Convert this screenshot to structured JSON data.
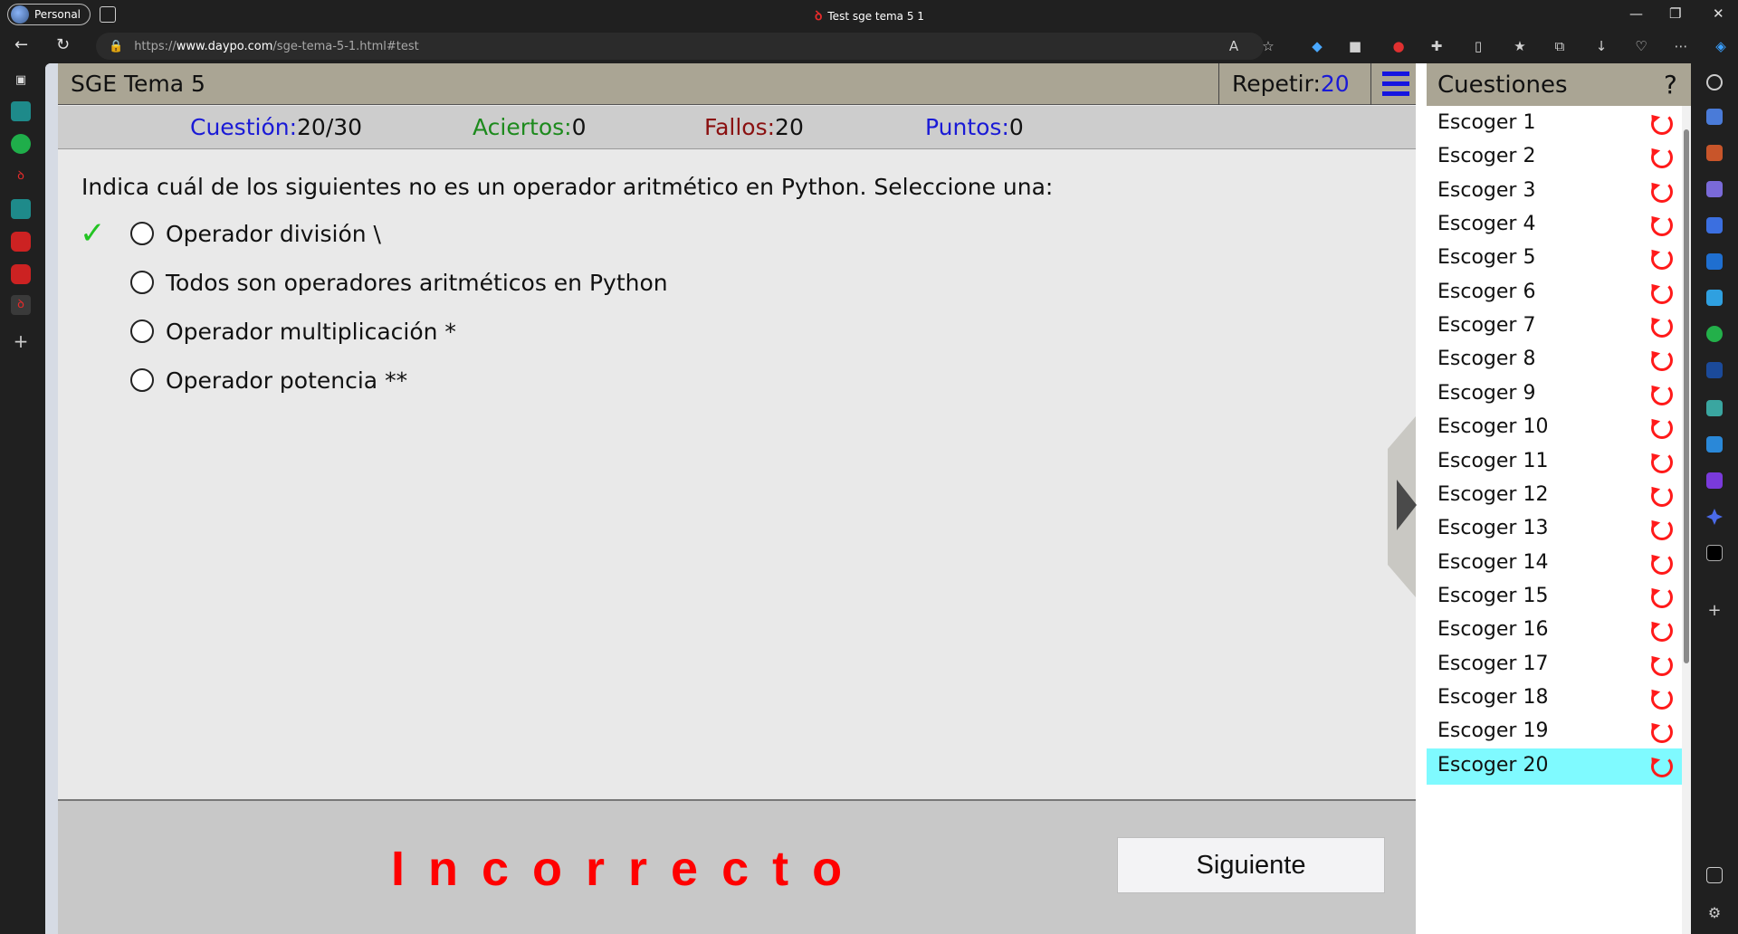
{
  "browser": {
    "profile_label": "Personal",
    "tab_title": "Test sge tema 5 1",
    "url_prefix": "https://",
    "url_domain": "www.daypo.com",
    "url_path": "/sge-tema-5-1.html#test"
  },
  "quiz": {
    "title": "SGE Tema 5",
    "repeat_label": "Repetir:",
    "repeat_value": "20",
    "stats": {
      "question_label": "Cuestión:",
      "question_value": "20/30",
      "correct_label": "Aciertos:",
      "correct_value": "0",
      "fails_label": "Fallos:",
      "fails_value": "20",
      "points_label": "Puntos:",
      "points_value": "0"
    },
    "question_text": "Indica cuál de los siguientes no es un operador aritmético en Python. Seleccione una:",
    "options": [
      "Operador división \\",
      "Todos son operadores aritméticos en Python",
      "Operador multiplicación *",
      "Operador potencia **"
    ],
    "correct_option_index": 0,
    "result_text": "Incorrecto",
    "next_button": "Siguiente"
  },
  "questions_panel": {
    "title": "Cuestiones",
    "help": "?",
    "active_index": 19,
    "items": [
      "Escoger 1",
      "Escoger 2",
      "Escoger 3",
      "Escoger 4",
      "Escoger 5",
      "Escoger 6",
      "Escoger 7",
      "Escoger 8",
      "Escoger 9",
      "Escoger 10",
      "Escoger 11",
      "Escoger 12",
      "Escoger 13",
      "Escoger 14",
      "Escoger 15",
      "Escoger 16",
      "Escoger 17",
      "Escoger 18",
      "Escoger 19",
      "Escoger 20"
    ]
  },
  "colors": {
    "header_bg": "#aaa594",
    "accent_blue": "#1a1ad6",
    "result_red": "#ff0000",
    "active_item": "#7ffaff",
    "check_green": "#23c423"
  }
}
